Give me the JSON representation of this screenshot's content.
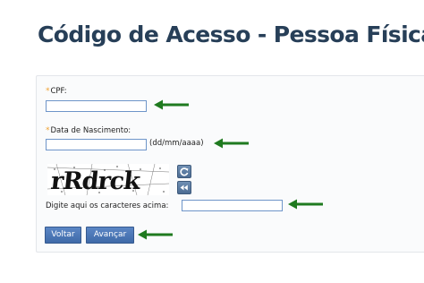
{
  "page": {
    "title": "Código de Acesso - Pessoa Física"
  },
  "form": {
    "cpf": {
      "label": "CPF:",
      "required_mark": "*",
      "value": ""
    },
    "birth_date": {
      "label": "Data de Nascimento:",
      "required_mark": "*",
      "value": "",
      "format_hint": "(dd/mm/aaaa)"
    },
    "captcha": {
      "image_text": "rRdrck",
      "label": "Digite aqui os caracteres acima:",
      "value": "",
      "refresh_icon": "refresh-icon",
      "audio_icon": "audio-icon"
    },
    "buttons": {
      "back_label": "Voltar",
      "next_label": "Avançar"
    }
  },
  "colors": {
    "title": "#273f58",
    "button": "#4a76b5",
    "arrow": "#1f7a1f",
    "required": "#f0a030"
  }
}
